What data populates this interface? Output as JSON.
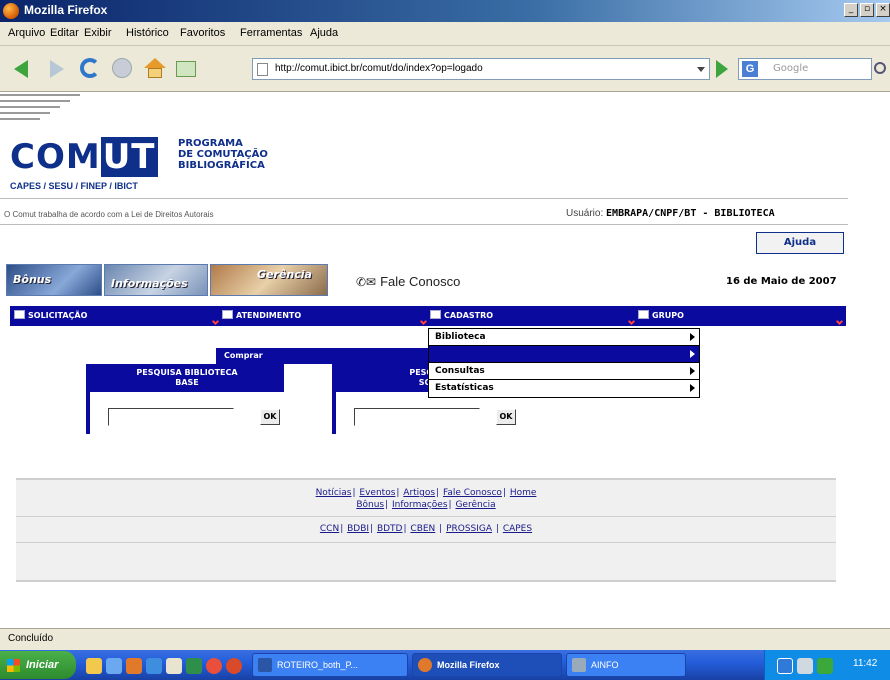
{
  "window": {
    "title": "Mozilla Firefox",
    "buttons": [
      "_",
      "▫",
      "×"
    ]
  },
  "menu": [
    "Arquivo",
    "Editar",
    "Exibir",
    "Histórico",
    "Favoritos",
    "Ferramentas",
    "Ajuda"
  ],
  "toolbar": {
    "url": "http://comut.ibict.br/comut/do/index?op=logado",
    "search_placeholder": "Google",
    "search_engine_letter": "G"
  },
  "site": {
    "logo": "COMUT",
    "logo_part1": "COM",
    "logo_part2": "UT",
    "program_lines": [
      "PROGRAMA",
      "DE COMUTAÇÃO",
      "BIBLIOGRÁFICA"
    ],
    "partners": "CAPES / SESU / FINEP / IBICT",
    "copyright": "O Comut trabalha de acordo com a Lei de Direitos Autorais",
    "user_label": "Usuário:",
    "user_value": "EMBRAPA/CNPF/BT - BIBLIOTECA",
    "help_button": "Ajuda",
    "banners": [
      "Bônus",
      "Informações",
      "Gerência"
    ],
    "contact": "Fale Conosco",
    "contact_icons": "✆✉",
    "date": "16 de Maio de 2007"
  },
  "nav": [
    {
      "label": "SOLICITAÇÃO"
    },
    {
      "label": "ATENDIMENTO"
    },
    {
      "label": "CADASTRO"
    },
    {
      "label": "GRUPO"
    }
  ],
  "dropdown": [
    {
      "label": "Biblioteca",
      "highlighted": false
    },
    {
      "label": "",
      "highlighted": true
    },
    {
      "label": "Consultas",
      "highlighted": false
    },
    {
      "label": "Estatísticas",
      "highlighted": false
    }
  ],
  "submenu": {
    "label": "Comprar"
  },
  "search_boxes": [
    {
      "title_line1": "PESQUISA BIBLIOTECA",
      "title_line2": "BASE",
      "value": "",
      "button": "OK"
    },
    {
      "title_line1": "PESQUISA",
      "title_line2": "SOLIC",
      "value": "",
      "button": "OK"
    }
  ],
  "footer": {
    "row1": [
      "Notícias",
      "Eventos",
      "Artigos",
      "Fale Conosco",
      "Home"
    ],
    "row2": [
      "Bônus",
      "Informações",
      "Gerência"
    ],
    "row3": [
      "CCN",
      "BDBI",
      "BDTD",
      "CBEN",
      "PROSSIGA",
      "CAPES"
    ]
  },
  "statusbar": {
    "text": "Concluído"
  },
  "taskbar": {
    "start": "Iniciar",
    "tasks": [
      {
        "label": "ROTEIRO_both_P...",
        "active": false
      },
      {
        "label": "Mozilla Firefox",
        "active": true
      },
      {
        "label": "AINFO",
        "active": false
      }
    ],
    "clock": "11:42",
    "colors": {
      "accent": "#0a0a9e",
      "taskbar": "#245edb",
      "start": "#2e8b2e"
    }
  }
}
